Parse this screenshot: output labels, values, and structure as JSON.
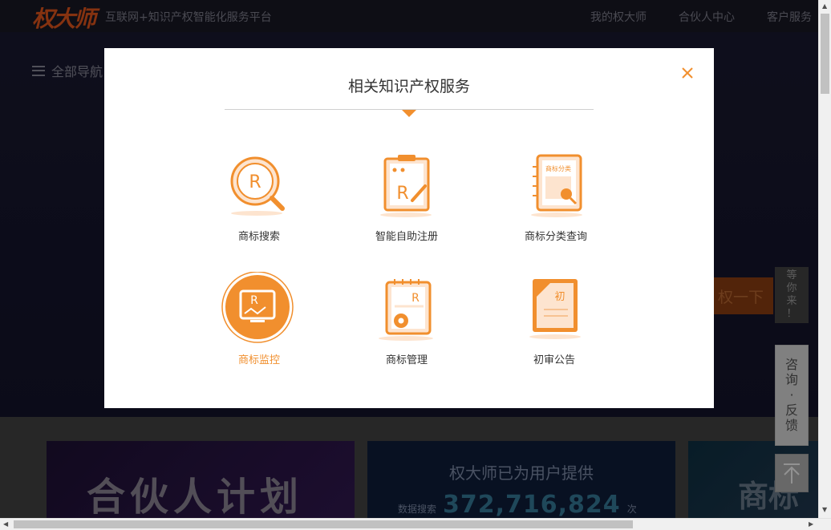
{
  "header": {
    "logo": "权大师",
    "tagline": "互联网+知识产权智能化服务平台",
    "nav": [
      "我的权大师",
      "合伙人中心",
      "客户服务"
    ]
  },
  "hero": {
    "all_nav": "全部导航",
    "try_button": "权一下"
  },
  "modal": {
    "title": "相关知识产权服务",
    "services": [
      {
        "label": "商标搜索",
        "icon": "trademark-search-icon"
      },
      {
        "label": "智能自助注册",
        "icon": "smart-registration-icon"
      },
      {
        "label": "商标分类查询",
        "icon": "classification-query-icon"
      },
      {
        "label": "商标监控",
        "icon": "trademark-monitor-icon",
        "active": true
      },
      {
        "label": "商标管理",
        "icon": "trademark-management-icon"
      },
      {
        "label": "初审公告",
        "icon": "preliminary-announcement-icon"
      }
    ],
    "icon_texts": {
      "classify": "商标分类",
      "first": "初"
    }
  },
  "cards": {
    "partner": "合伙人计划",
    "stats_title": "权大师已为用户提供",
    "stats_label": "数据搜索",
    "stats_value": "372,716,824",
    "stats_unit": "次",
    "third": "商标"
  },
  "float": {
    "wait": "等你来！",
    "consult": "咨询·反馈"
  },
  "colors": {
    "accent": "#f18f2e",
    "accent_light": "#fde4cf"
  }
}
